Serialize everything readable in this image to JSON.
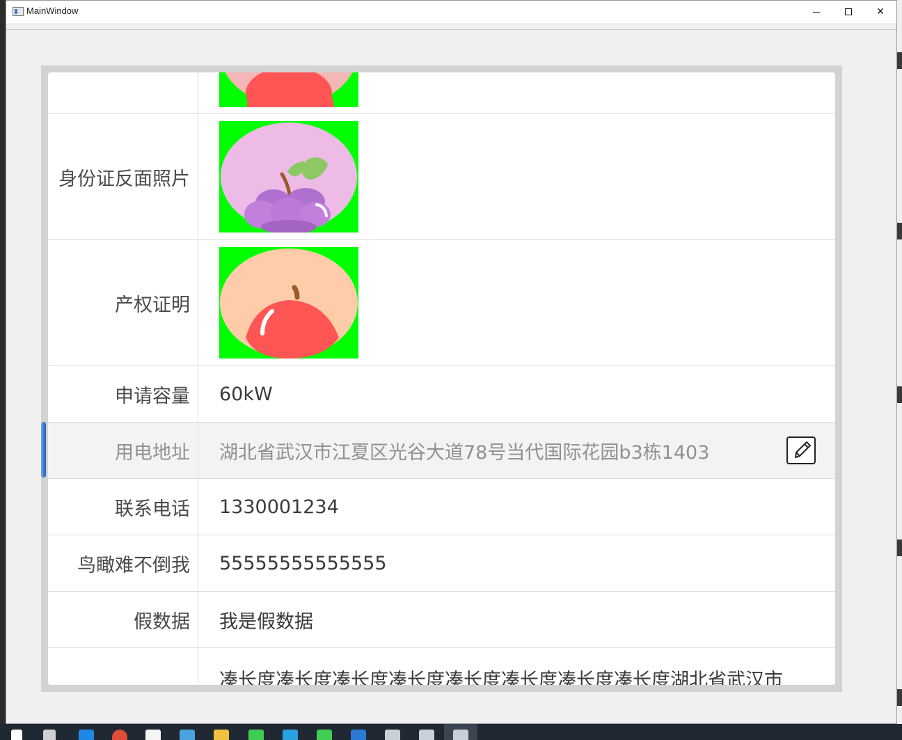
{
  "window": {
    "title": "MainWindow",
    "minimize_label": "",
    "maximize_label": "",
    "close_label": "✕"
  },
  "rows": [
    {
      "label": "",
      "value": "",
      "kind": "image",
      "image": "apple-image-partial"
    },
    {
      "label": "身份证反面照片",
      "value": "",
      "kind": "image",
      "image": "grapes-image"
    },
    {
      "label": "产权证明",
      "value": "",
      "kind": "image",
      "image": "apple-image"
    },
    {
      "label": "申请容量",
      "value": "60kW",
      "kind": "text"
    },
    {
      "label": "用电地址",
      "value": "湖北省武汉市江夏区光谷大道78号当代国际花园b3栋1403",
      "kind": "text",
      "selected": true,
      "editable": true
    },
    {
      "label": "联系电话",
      "value": "1330001234",
      "kind": "text"
    },
    {
      "label": "鸟瞰难不倒我",
      "value": "55555555555555",
      "kind": "text"
    },
    {
      "label": "假数据",
      "value": "我是假数据",
      "kind": "text"
    },
    {
      "label": "",
      "value": "凑长度凑长度凑长度凑长度凑长度凑长度凑长度凑长度湖北省武汉市",
      "kind": "text"
    }
  ],
  "icons": {
    "edit": "edit-pencil-icon",
    "app": "window-app-icon"
  },
  "colors": {
    "thumb_background": "#00ff00",
    "selection_accent": "#1e5fb4",
    "apple_red": "#ff5555",
    "grape_purple": "#b070d0",
    "peach_bg": "#ffccaa",
    "pink_bg": "#eebbdd"
  }
}
